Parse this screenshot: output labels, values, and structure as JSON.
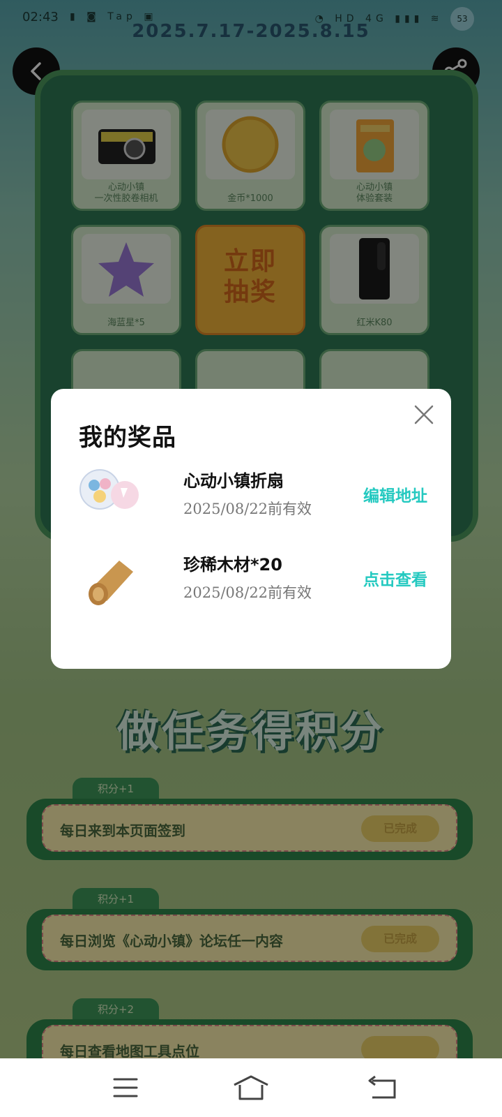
{
  "status_bar": {
    "time": "02:43",
    "notif_text": "▮  ◙  Tap  ▣",
    "right_text": "◔  HD  4G  ▮▮▮  ≋",
    "battery": "53"
  },
  "header": {
    "date_range": "2025.7.17-2025.8.15"
  },
  "prize_grid": {
    "prizes": [
      {
        "name": "心动小镇\n一次性胶卷相机"
      },
      {
        "name": "金币*1000"
      },
      {
        "name": "心动小镇\n体验套装"
      },
      {
        "name": "海蓝星*5"
      },
      {
        "name": "立即\n抽奖"
      },
      {
        "name": "红米K80"
      }
    ]
  },
  "tasks": {
    "title": "做任务得积分",
    "items": [
      {
        "tag": "积分+1",
        "label": "每日来到本页面签到",
        "status": "已完成"
      },
      {
        "tag": "积分+1",
        "label": "每日浏览《心动小镇》论坛任一内容",
        "status": "已完成"
      },
      {
        "tag": "积分+2",
        "label": "每日查看地图工具点位",
        "status": ""
      }
    ]
  },
  "modal": {
    "title": "我的奖品",
    "items": [
      {
        "name": "心动小镇折扇",
        "valid": "2025/08/22前有效",
        "action": "编辑地址"
      },
      {
        "name": "珍稀木材*20",
        "valid": "2025/08/22前有效",
        "action": "点击查看"
      }
    ]
  }
}
